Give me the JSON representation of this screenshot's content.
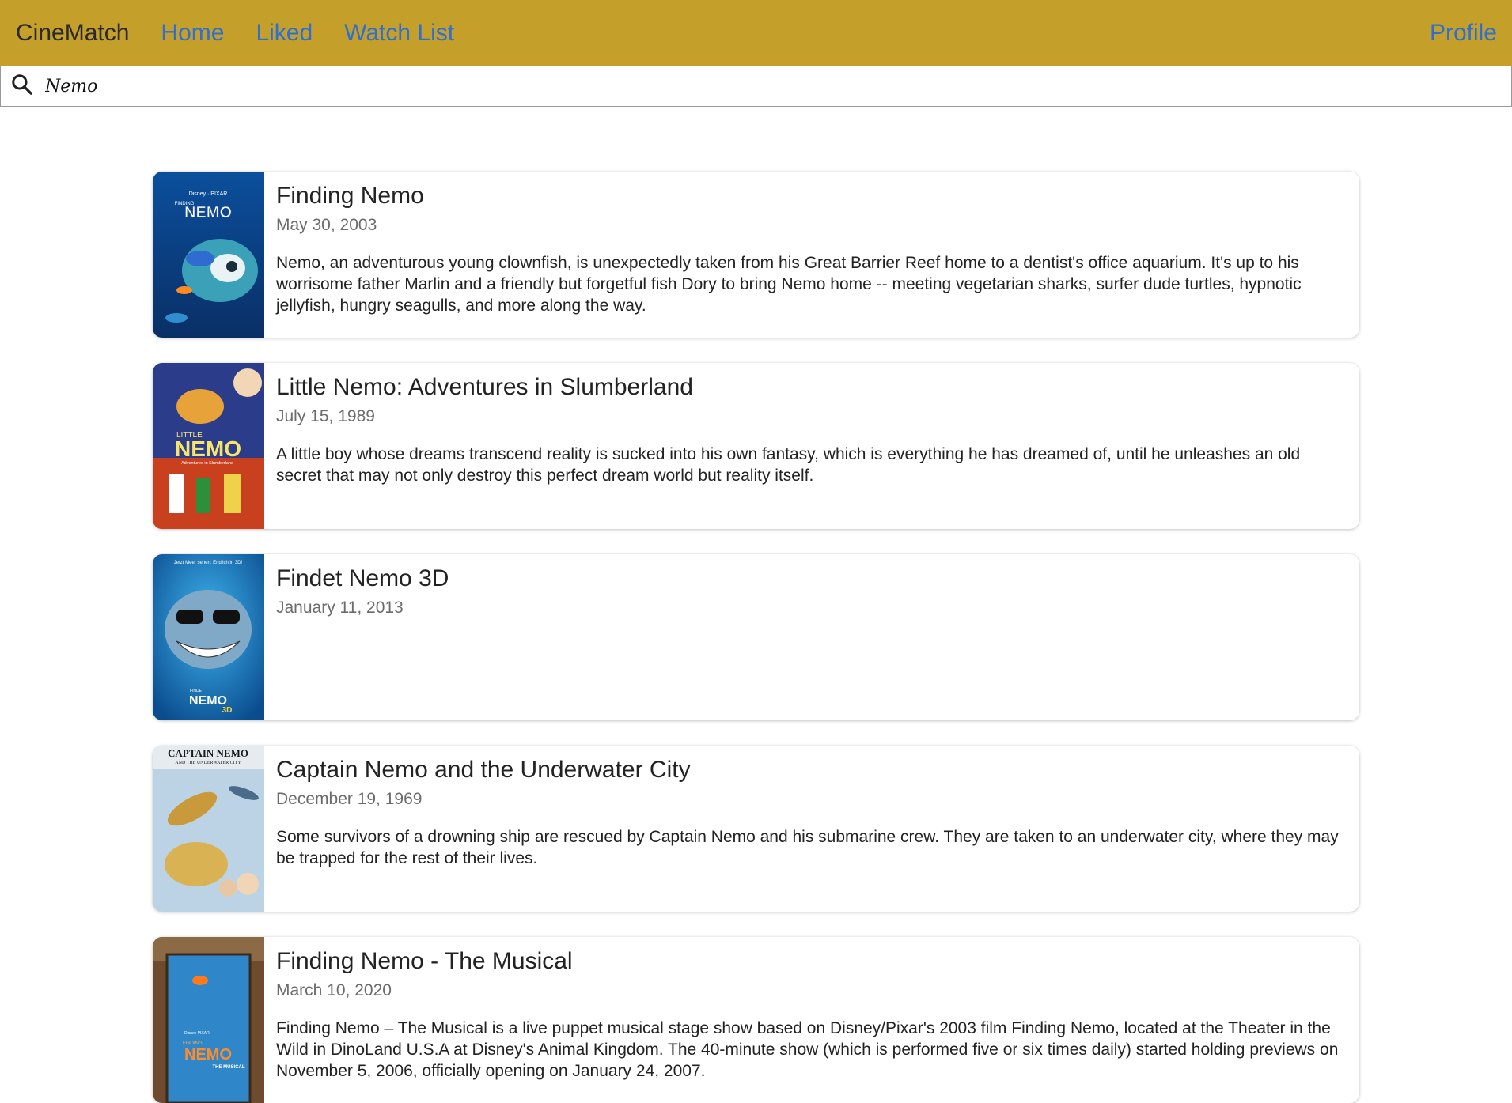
{
  "navbar": {
    "brand": "CineMatch",
    "links": [
      "Home",
      "Liked",
      "Watch List"
    ],
    "profile": "Profile",
    "background": "#c49f2a",
    "link_color": "#2f6fd1"
  },
  "search": {
    "value": "Nemo",
    "icon": "search-icon"
  },
  "results": [
    {
      "title": "Finding Nemo",
      "date": "May 30, 2003",
      "description": "Nemo, an adventurous young clownfish, is unexpectedly taken from his Great Barrier Reef home to a dentist's office aquarium. It's up to his worrisome father Marlin and a friendly but forgetful fish Dory to bring Nemo home -- meeting vegetarian sharks, surfer dude turtles, hypnotic jellyfish, hungry seagulls, and more along the way.",
      "poster_text": [
        "Disney · PIXAR",
        "FINDING",
        "NEMO"
      ]
    },
    {
      "title": "Little Nemo: Adventures in Slumberland",
      "date": "July 15, 1989",
      "description": "A little boy whose dreams transcend reality is sucked into his own fantasy, which is everything he has dreamed of, until he unleashes an old secret that may not only destroy this perfect dream world but reality itself.",
      "poster_text": [
        "LITTLE",
        "NEMO",
        "Adventures in Slumberland"
      ]
    },
    {
      "title": "Findet Nemo 3D",
      "date": "January 11, 2013",
      "description": "",
      "poster_text": [
        "Jetzt Meer sehen: Endlich in 3D!",
        "FINDET",
        "NEMO",
        "3D"
      ]
    },
    {
      "title": "Captain Nemo and the Underwater City",
      "date": "December 19, 1969",
      "description": "Some survivors of a drowning ship are rescued by Captain Nemo and his submarine crew. They are taken to an underwater city, where they may be trapped for the rest of their lives.",
      "poster_text": [
        "CAPTAIN NEMO",
        "AND THE UNDERWATER CITY"
      ]
    },
    {
      "title": "Finding Nemo - The Musical",
      "date": "March 10, 2020",
      "description": "Finding Nemo – The Musical is a live puppet musical stage show based on Disney/Pixar's 2003 film Finding Nemo, located at the Theater in the Wild in DinoLand U.S.A at Disney's Animal Kingdom. The 40-minute show (which is performed five or six times daily) started holding previews on November 5, 2006, officially opening on January 24, 2007.",
      "poster_text": [
        "Disney PIXAR",
        "FINDING",
        "NEMO",
        "THE MUSICAL"
      ]
    }
  ]
}
